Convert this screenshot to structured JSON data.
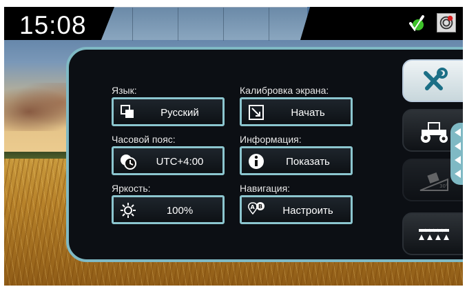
{
  "status_bar": {
    "time": "15:08",
    "gps_icon": "gps-fix-icon",
    "alert_icon": "alarm-icon"
  },
  "settings": {
    "language": {
      "label": "Язык:",
      "value": "Русский",
      "icon": "language-icon"
    },
    "timezone": {
      "label": "Часовой пояс:",
      "value": "UTC+4:00",
      "icon": "clock-icon"
    },
    "brightness": {
      "label": "Яркость:",
      "value": "100%",
      "icon": "sun-icon"
    },
    "calibration": {
      "label": "Калибровка экрана:",
      "value": "Начать",
      "icon": "calibrate-icon"
    },
    "info": {
      "label": "Информация:",
      "value": "Показать",
      "icon": "info-icon"
    },
    "navigation": {
      "label": "Навигация:",
      "value": "Настроить",
      "icon": "ab-line-icon"
    }
  },
  "tabs": [
    {
      "name": "settings",
      "icon": "wrench-screwdriver-icon",
      "active": true
    },
    {
      "name": "tractor",
      "icon": "tractor-icon",
      "active": false
    },
    {
      "name": "tilt",
      "icon": "tilt-icon",
      "active": false
    },
    {
      "name": "sprayer",
      "icon": "sprayer-boom-icon",
      "active": false
    }
  ],
  "colors": {
    "accent": "#7fb9c4",
    "panel": "#0c0f14",
    "gps_green": "#3ec22a"
  }
}
